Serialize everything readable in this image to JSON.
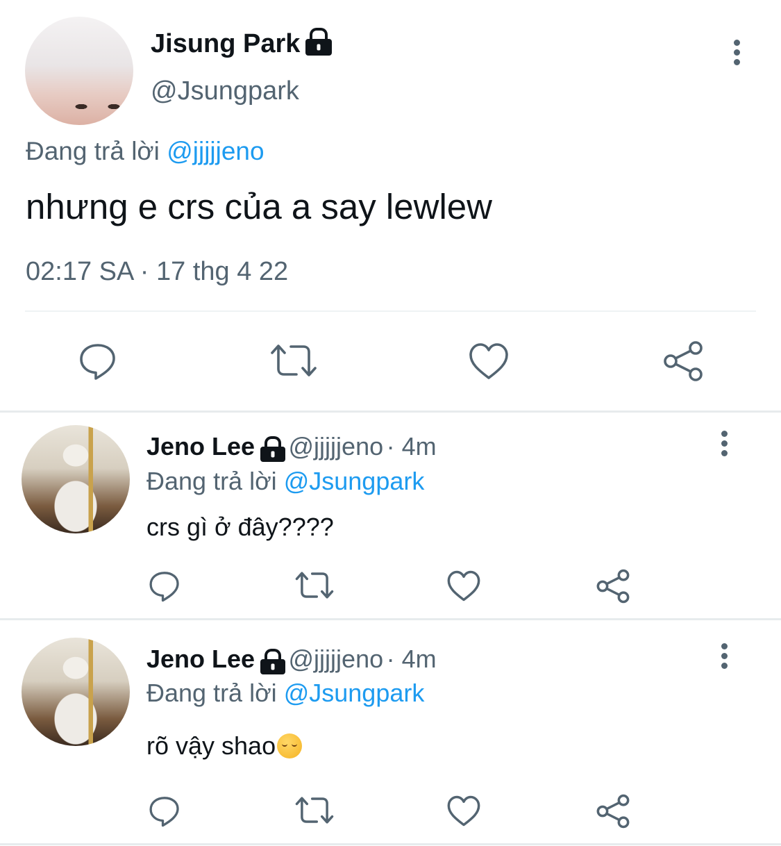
{
  "main_tweet": {
    "name": "Jisung Park",
    "handle": "@Jsungpark",
    "replying_prefix": "Đang trả lời",
    "replying_to": "@jjjjjeno",
    "text": "nhưng e crs của a say lewlew",
    "timestamp": "02:17 SA · 17 thg 4 22"
  },
  "replies": [
    {
      "name": "Jeno Lee",
      "handle": "@jjjjjeno",
      "time": "· 4m",
      "replying_prefix": "Đang trả lời",
      "replying_to": "@Jsungpark",
      "text": "crs gì ở đây????"
    },
    {
      "name": "Jeno Lee",
      "handle": "@jjjjjeno",
      "time": "· 4m",
      "replying_prefix": "Đang trả lời",
      "replying_to": "@Jsungpark",
      "text": "rõ vậy shao",
      "emoji": "pensive-face-emoji"
    }
  ],
  "icons": [
    "lock-icon",
    "more-icon",
    "reply-icon",
    "retweet-icon",
    "like-icon",
    "share-icon"
  ],
  "colors": {
    "text": "#0f1419",
    "muted": "#536471",
    "link": "#1d9bf0",
    "divider": "#e7ebed"
  }
}
